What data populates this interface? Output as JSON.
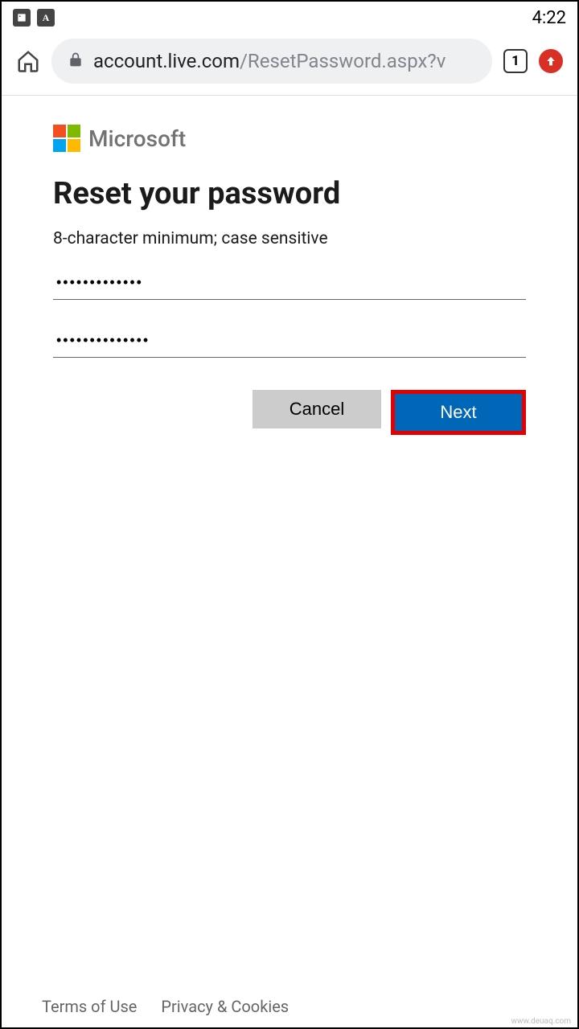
{
  "statusbar": {
    "time": "4:22"
  },
  "browser": {
    "url_host": "account.live.com",
    "url_path": "/ResetPassword.aspx?v",
    "tab_count": "1"
  },
  "page": {
    "brand": "Microsoft",
    "title": "Reset your password",
    "hint": "8-character minimum; case sensitive",
    "password1": "•••••••••••••",
    "password2": "••••••••••••••",
    "cancel_label": "Cancel",
    "next_label": "Next"
  },
  "footer": {
    "terms": "Terms of Use",
    "privacy": "Privacy & Cookies"
  },
  "watermark": "www.deuaq.com"
}
